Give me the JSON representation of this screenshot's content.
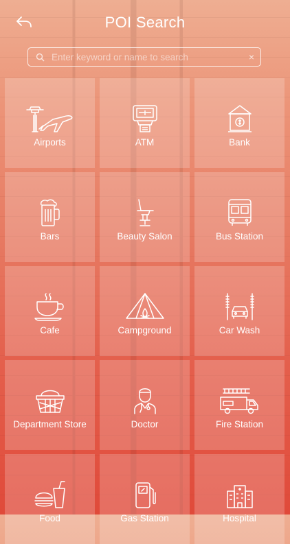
{
  "header": {
    "title": "POI Search"
  },
  "search": {
    "placeholder": "Enter keyword or name to search",
    "value": "",
    "clear_glyph": "×"
  },
  "categories": [
    {
      "label": "Airports",
      "icon": "airport-icon"
    },
    {
      "label": "ATM",
      "icon": "atm-icon"
    },
    {
      "label": "Bank",
      "icon": "bank-icon"
    },
    {
      "label": "Bars",
      "icon": "beer-mug-icon"
    },
    {
      "label": "Beauty Salon",
      "icon": "salon-chair-icon"
    },
    {
      "label": "Bus Station",
      "icon": "bus-icon"
    },
    {
      "label": "Cafe",
      "icon": "coffee-cup-icon"
    },
    {
      "label": "Campground",
      "icon": "tent-icon"
    },
    {
      "label": "Car Wash",
      "icon": "car-wash-icon"
    },
    {
      "label": "Department Store",
      "icon": "shopping-basket-icon"
    },
    {
      "label": "Doctor",
      "icon": "doctor-icon"
    },
    {
      "label": "Fire Station",
      "icon": "fire-truck-icon"
    },
    {
      "label": "Food",
      "icon": "fast-food-icon"
    },
    {
      "label": "Gas Station",
      "icon": "gas-pump-icon"
    },
    {
      "label": "Hospital",
      "icon": "hospital-icon"
    }
  ],
  "colors": {
    "gradient_top": "#eeae92",
    "gradient_bottom": "#e04a3a",
    "tile": "rgba(255,255,255,0.20)"
  }
}
